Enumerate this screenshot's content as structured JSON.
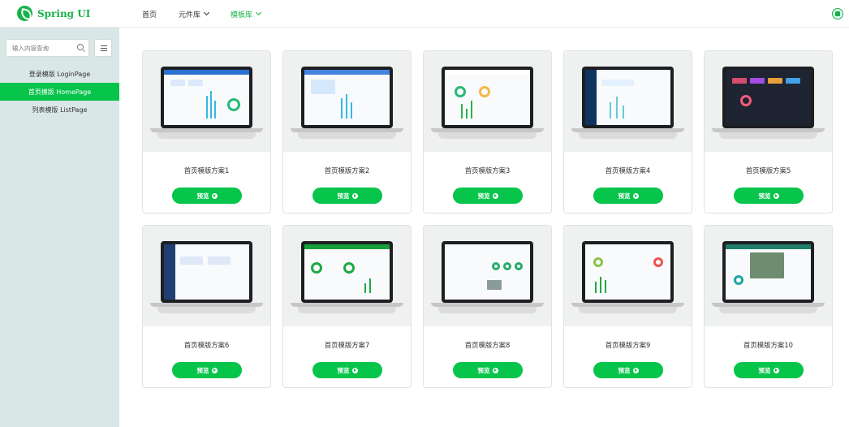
{
  "app": {
    "title": "Spring UI"
  },
  "nav": {
    "items": [
      {
        "label": "首页"
      },
      {
        "label": "元件库"
      },
      {
        "label": "模板库"
      }
    ]
  },
  "sidebar": {
    "search_placeholder": "输入内容查询",
    "items": [
      {
        "label": "登录模版 LoginPage"
      },
      {
        "label": "首页模版 HomePage"
      },
      {
        "label": "列表模版 ListPage"
      }
    ]
  },
  "cards": [
    {
      "title": "首页模版方案1",
      "button": "预览"
    },
    {
      "title": "首页模版方案2",
      "button": "预览"
    },
    {
      "title": "首页模版方案3",
      "button": "预览"
    },
    {
      "title": "首页模版方案4",
      "button": "预览"
    },
    {
      "title": "首页模版方案5",
      "button": "预览"
    },
    {
      "title": "首页模版方案6",
      "button": "预览"
    },
    {
      "title": "首页模版方案7",
      "button": "预览"
    },
    {
      "title": "首页模版方案8",
      "button": "预览"
    },
    {
      "title": "首页模版方案9",
      "button": "预览"
    },
    {
      "title": "首页模版方案10",
      "button": "预览"
    }
  ],
  "colors": {
    "accent": "#07c44b",
    "sidebar": "#d9e7e6"
  },
  "icons": [
    "spring-logo-icon",
    "chevron-down-icon",
    "search-icon",
    "list-menu-icon",
    "play-circle-icon",
    "profile-icon"
  ]
}
